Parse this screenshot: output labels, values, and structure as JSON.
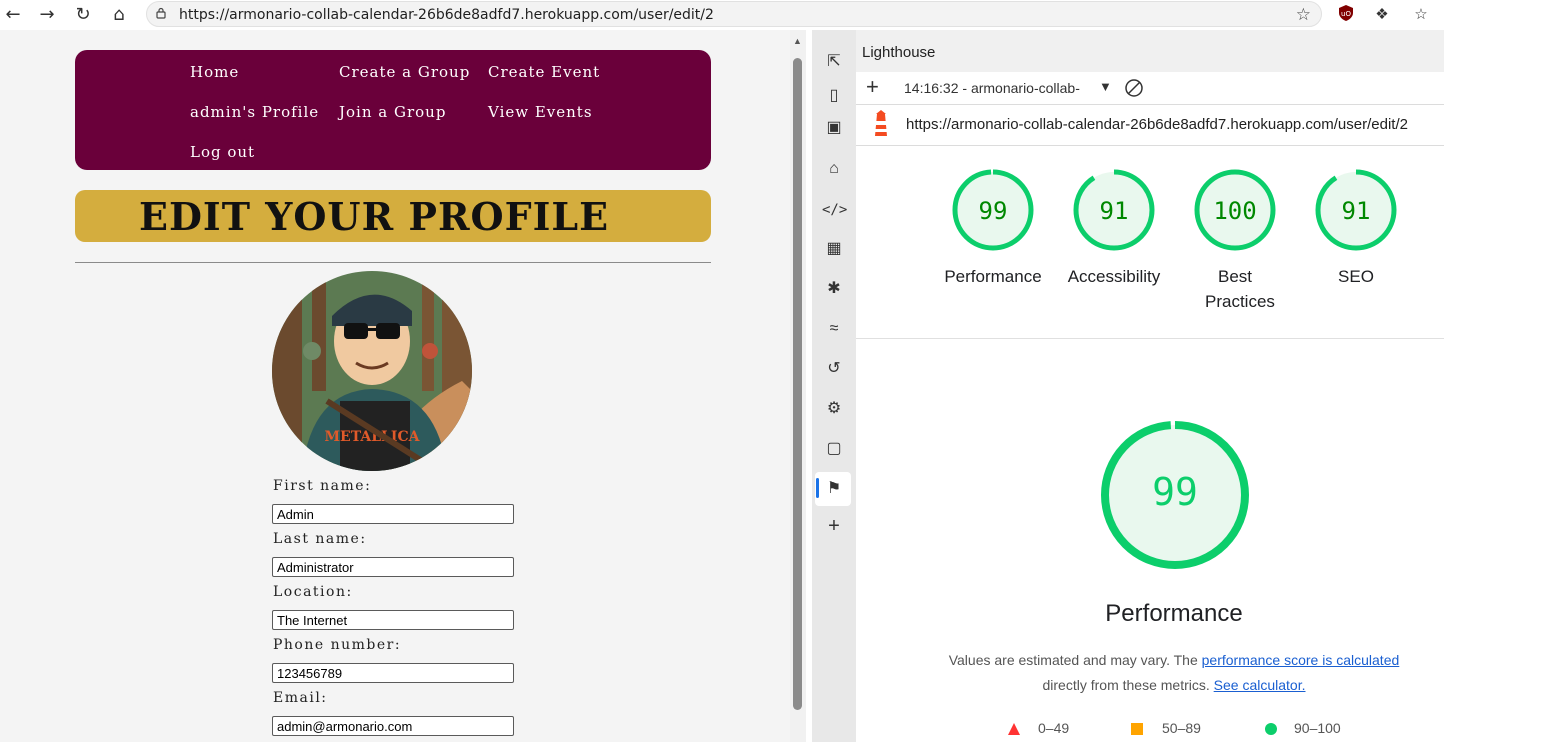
{
  "browser": {
    "url": "https://armonario-collab-calendar-26b6de8adfd7.herokuapp.com/user/edit/2"
  },
  "site": {
    "nav": {
      "home": "Home",
      "create_group": "Create a Group",
      "create_event": "Create Event",
      "profile": "admin's Profile",
      "join_group": "Join a Group",
      "view_events": "View Events",
      "logout": "Log out"
    },
    "title": "EDIT YOUR PROFILE",
    "form": {
      "first_name_label": "First name:",
      "first_name_value": "Admin",
      "last_name_label": "Last name:",
      "last_name_value": "Administrator",
      "location_label": "Location:",
      "location_value": "The Internet",
      "phone_label": "Phone number:",
      "phone_value": "123456789",
      "email_label": "Email:",
      "email_value": "admin@armonario.com"
    }
  },
  "devtools": {
    "panel_title": "Lighthouse",
    "report_time": "14:16:32 - armonario-collab-",
    "report_url": "https://armonario-collab-calendar-26b6de8adfd7.herokuapp.com/user/edit/2",
    "scores": [
      {
        "label": "Performance",
        "value": "99",
        "score": 99
      },
      {
        "label": "Accessibility",
        "value": "91",
        "score": 91
      },
      {
        "label": "Best Practices",
        "value": "100",
        "score": 100
      },
      {
        "label": "SEO",
        "value": "91",
        "score": 91
      }
    ],
    "detail": {
      "score": "99",
      "title": "Performance",
      "desc_prefix": "Values are estimated and may vary. The",
      "desc_link": "performance score is calculated",
      "desc_middle": "directly from these metrics.",
      "desc_link2": "See calculator."
    },
    "legend": {
      "fail": "0–49",
      "average": "50–89",
      "pass": "90–100"
    },
    "colors": {
      "pass": "#0cce6b",
      "pass_text": "#008800",
      "average": "#ffa400",
      "fail": "#ff3333"
    }
  },
  "colors": {
    "nav_bg": "#6a003a",
    "title_bg": "#d4ad3e"
  }
}
